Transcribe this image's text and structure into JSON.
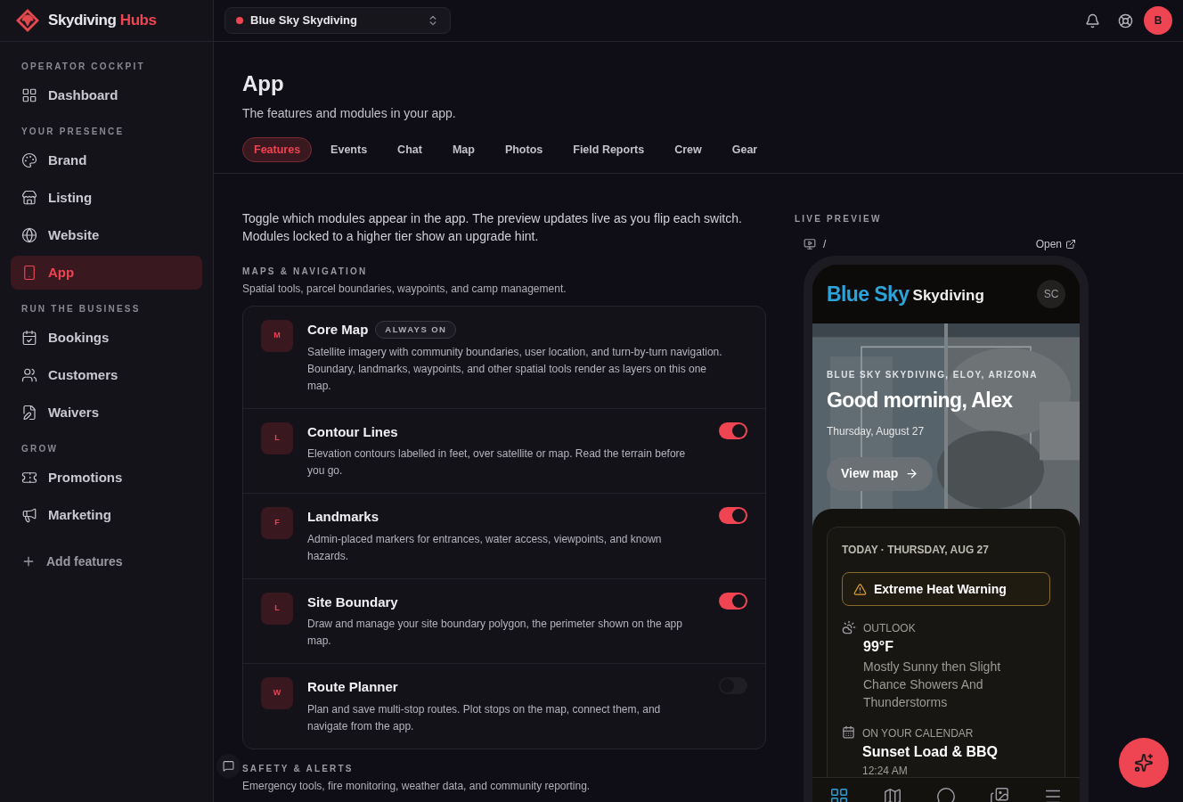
{
  "brand": {
    "name": "Skydiving",
    "accent": "Hubs"
  },
  "workspace": {
    "name": "Blue Sky Skydiving",
    "color": "#ef4452"
  },
  "user": {
    "initial": "B"
  },
  "sidebar": {
    "sections": [
      {
        "heading": "OPERATOR COCKPIT",
        "items": [
          {
            "label": "Dashboard",
            "selected": false
          }
        ]
      },
      {
        "heading": "YOUR PRESENCE",
        "items": [
          {
            "label": "Brand",
            "selected": false
          },
          {
            "label": "Listing",
            "selected": false
          },
          {
            "label": "Website",
            "selected": false
          },
          {
            "label": "App",
            "selected": true
          }
        ]
      },
      {
        "heading": "RUN THE BUSINESS",
        "items": [
          {
            "label": "Bookings",
            "selected": false
          },
          {
            "label": "Customers",
            "selected": false
          },
          {
            "label": "Waivers",
            "selected": false
          }
        ]
      },
      {
        "heading": "GROW",
        "items": [
          {
            "label": "Promotions",
            "selected": false
          },
          {
            "label": "Marketing",
            "selected": false
          }
        ]
      }
    ],
    "add_features": "Add features"
  },
  "page": {
    "title": "App",
    "subtitle": "The features and modules in your app."
  },
  "tabs": [
    {
      "label": "Features",
      "selected": true
    },
    {
      "label": "Events",
      "selected": false
    },
    {
      "label": "Chat",
      "selected": false
    },
    {
      "label": "Map",
      "selected": false
    },
    {
      "label": "Photos",
      "selected": false
    },
    {
      "label": "Field Reports",
      "selected": false
    },
    {
      "label": "Crew",
      "selected": false
    },
    {
      "label": "Gear",
      "selected": false
    }
  ],
  "intro": "Toggle which modules appear in the app. The preview updates live as you flip each switch. Modules locked to a higher tier show an upgrade hint.",
  "groups": [
    {
      "heading": "MAPS & NAVIGATION",
      "description": "Spatial tools, parcel boundaries, waypoints, and camp management.",
      "modules": [
        {
          "letter": "M",
          "name": "Core Map",
          "badge": "ALWAYS ON",
          "kind": "fixed",
          "description": "Satellite imagery with community boundaries, user location, and turn-by-turn navigation. Boundary, landmarks, waypoints, and other spatial tools render as layers on this one map."
        },
        {
          "letter": "L",
          "name": "Contour Lines",
          "kind": "toggle",
          "on": true,
          "description": "Elevation contours labelled in feet, over satellite or map. Read the terrain before you go."
        },
        {
          "letter": "F",
          "name": "Landmarks",
          "kind": "toggle",
          "on": true,
          "description": "Admin-placed markers for entrances, water access, viewpoints, and known hazards."
        },
        {
          "letter": "L",
          "name": "Site Boundary",
          "kind": "toggle",
          "on": true,
          "description": "Draw and manage your site boundary polygon, the perimeter shown on the app map."
        },
        {
          "letter": "W",
          "name": "Route Planner",
          "kind": "toggle",
          "on": false,
          "description": "Plan and save multi-stop routes. Plot stops on the map, connect them, and navigate from the app."
        }
      ]
    },
    {
      "heading": "SAFETY & ALERTS",
      "description": "Emergency tools, fire monitoring, weather data, and community reporting."
    }
  ],
  "preview": {
    "heading": "LIVE PREVIEW",
    "path": "/",
    "open": "Open",
    "logo": {
      "primary": "Blue Sky",
      "secondary": "Skydiving"
    },
    "avatar": "SC",
    "hero": {
      "eyebrow": "BLUE SKY SKYDIVING, ELOY, ARIZONA",
      "greeting": "Good morning, Alex",
      "date": "Thursday, August 27",
      "button": "View map"
    },
    "today": {
      "heading": "TODAY · THURSDAY, AUG 27",
      "alert": "Extreme Heat Warning",
      "outlook_label": "OUTLOOK",
      "temperature": "99°F",
      "forecast": "Mostly Sunny then Slight Chance Showers And Thunderstorms",
      "calendar_label": "ON YOUR CALENDAR",
      "event": "Sunset Load & BBQ",
      "time": "12:24 AM"
    },
    "nav": [
      {
        "selected": true
      },
      {
        "selected": false
      },
      {
        "selected": false
      },
      {
        "selected": false
      },
      {
        "selected": false
      }
    ]
  }
}
